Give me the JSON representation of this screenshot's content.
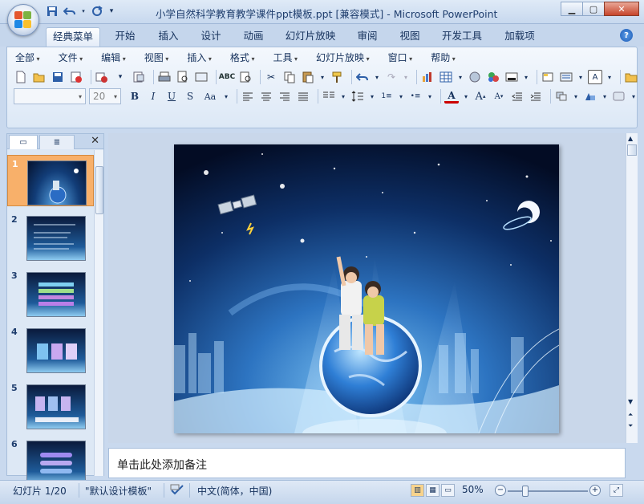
{
  "window": {
    "title": "小学自然科学教育教学课件ppt模板.ppt [兼容模式] - Microsoft PowerPoint",
    "controls": [
      "minimize",
      "maximize",
      "close"
    ]
  },
  "quick_access": {
    "icons": [
      "save-icon",
      "undo-icon",
      "redo-icon",
      "customize-icon"
    ]
  },
  "tabs": [
    "经典菜单",
    "开始",
    "插入",
    "设计",
    "动画",
    "幻灯片放映",
    "审阅",
    "视图",
    "开发工具",
    "加载项"
  ],
  "active_tab": "经典菜单",
  "menus": [
    "全部",
    "文件",
    "编辑",
    "视图",
    "插入",
    "格式",
    "工具",
    "幻灯片放映",
    "窗口",
    "帮助"
  ],
  "toolbar": {
    "font_name": "",
    "font_size": "20",
    "format_labels": {
      "bold": "B",
      "italic": "I",
      "underline": "U",
      "strike": "S",
      "case": "Aa",
      "font_color": "A"
    }
  },
  "slides_pane": {
    "tabs": [
      "slides-tab",
      "outline-tab"
    ],
    "slides": [
      {
        "number": "1",
        "selected": true
      },
      {
        "number": "2",
        "selected": false
      },
      {
        "number": "3",
        "selected": false
      },
      {
        "number": "4",
        "selected": false
      },
      {
        "number": "5",
        "selected": false
      },
      {
        "number": "6",
        "selected": false
      }
    ]
  },
  "notes": {
    "placeholder": "单击此处添加备注"
  },
  "status": {
    "slide_info": "幻灯片 1/20",
    "theme": "\"默认设计模板\"",
    "language": "中文(简体，中国)",
    "zoom": "50%",
    "zoom_percent": 50
  },
  "colors": {
    "ribbon_bg": "#dce8f6",
    "accent": "#f8b06a",
    "title_text": "#1f3e6e"
  }
}
